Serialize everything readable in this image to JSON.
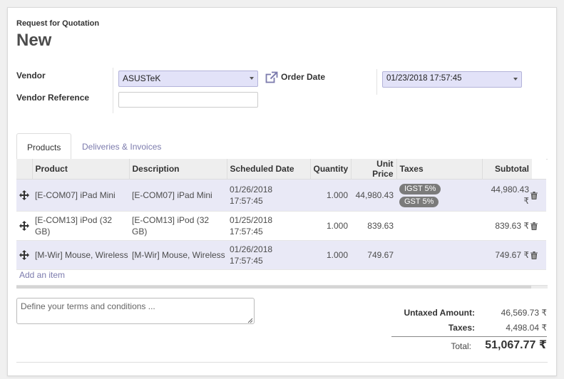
{
  "header": {
    "doc_type": "Request for Quotation",
    "title": "New"
  },
  "form": {
    "vendor_label": "Vendor",
    "vendor_value": "ASUSTeK",
    "vendor_ref_label": "Vendor Reference",
    "vendor_ref_value": "",
    "order_date_label": "Order Date",
    "order_date_value": "01/23/2018 17:57:45"
  },
  "tabs": [
    {
      "label": "Products",
      "active": true
    },
    {
      "label": "Deliveries & Invoices",
      "active": false
    }
  ],
  "table": {
    "headers": [
      "Product",
      "Description",
      "Scheduled Date",
      "Quantity",
      "Unit Price",
      "Taxes",
      "Subtotal"
    ],
    "rows": [
      {
        "product": "[E-COM07] iPad Mini",
        "description": "[E-COM07] iPad Mini",
        "date": "01/26/2018",
        "time": "17:57:45",
        "quantity": "1.000",
        "unit_price": "44,980.43",
        "taxes": [
          "IGST 5%",
          "GST 5%"
        ],
        "subtotal": "44,980.43 ₹"
      },
      {
        "product": "[E-COM13] iPod (32 GB)",
        "description": "[E-COM13] iPod (32 GB)",
        "date": "01/25/2018",
        "time": "17:57:45",
        "quantity": "1.000",
        "unit_price": "839.63",
        "taxes": [],
        "subtotal": "839.63 ₹"
      },
      {
        "product": "[M-Wir] Mouse, Wireless",
        "description": "[M-Wir] Mouse, Wireless",
        "date": "01/26/2018",
        "time": "17:57:45",
        "quantity": "1.000",
        "unit_price": "749.67",
        "taxes": [],
        "subtotal": "749.67 ₹"
      }
    ],
    "add_item_label": "Add an item"
  },
  "terms": {
    "placeholder": "Define your terms and conditions ..."
  },
  "totals": {
    "untaxed_label": "Untaxed Amount:",
    "untaxed_value": "46,569.73 ₹",
    "taxes_label": "Taxes:",
    "taxes_value": "4,498.04 ₹",
    "total_label": "Total:",
    "total_value": "51,067.77 ₹"
  },
  "icons": {
    "external_link": "external-link-icon",
    "drag_handle": "move-icon",
    "delete": "trash-icon",
    "dropdown": "chevron-down-icon"
  },
  "colors": {
    "accent_link": "#7c7bad",
    "select_bg": "#e2e2f8",
    "odd_row_bg": "#e9e9f6",
    "tag_bg": "#7b7b7b"
  }
}
